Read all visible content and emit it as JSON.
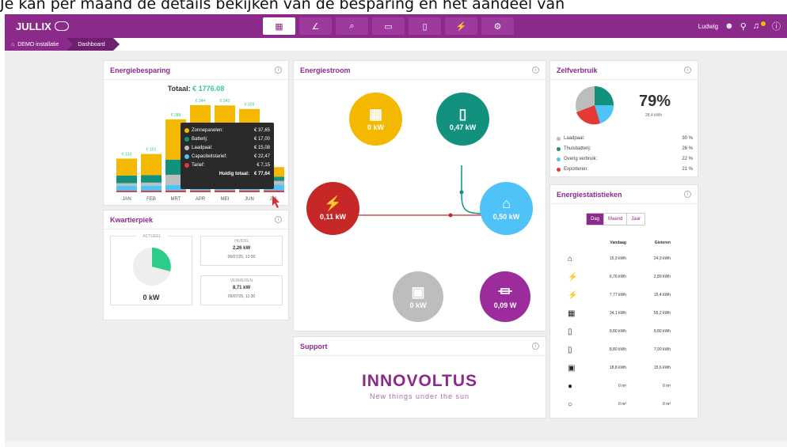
{
  "caption": "Je kan per maand de details bekijken van de besparing en het aandeel van",
  "app": {
    "logo": "JULLIX"
  },
  "nav": {
    "buttons": [
      "▦",
      "∠",
      "⌕",
      "▭",
      "▯",
      "⚡",
      "⚙"
    ]
  },
  "user": {
    "name": "Ludwig"
  },
  "breadcrumb": {
    "home": "⌂",
    "level1": "DEMO installatie",
    "level2": "Dashboard"
  },
  "cards": {
    "savings": {
      "title": "Energiebesparing",
      "total_label": "Totaal:",
      "total_value": "€ 1776.08"
    },
    "peak": {
      "title": "Kwartierpiek",
      "current_label": "ACTUEEL",
      "current_value": "0 kW",
      "today_label": "HUIDIG",
      "today_value": "2,26 kW",
      "today_date": "06/07/25, 12:00",
      "prev_label": "VERMEDEN",
      "prev_value": "8,71 kW",
      "prev_date": "09/07/25, 11:30"
    },
    "flow": {
      "title": "Energiestroom",
      "solar": "0 kW",
      "battery": "0,47 kW",
      "grid": "0,11 kW",
      "home": "0,50 kW",
      "car": "0 kW",
      "plug": "0,09 W"
    },
    "self": {
      "title": "Zelfverbruik",
      "percent": "79%",
      "sub": "28,4 kWh",
      "legend": [
        {
          "name": "Laadpaal:",
          "value": "30 %",
          "color": "#bdbdbd"
        },
        {
          "name": "Thuisbatterij:",
          "value": "26 %",
          "color": "#11917e"
        },
        {
          "name": "Overig verbruik:",
          "value": "22 %",
          "color": "#4fc3f7"
        },
        {
          "name": "Exporteren:",
          "value": "21 %",
          "color": "#e53935"
        }
      ]
    },
    "stats": {
      "title": "Energiestatistieken",
      "tabs": [
        "Dag",
        "Maand",
        "Jaar"
      ],
      "col_today": "Vandaag",
      "col_yesterday": "Gisteren",
      "rows": [
        {
          "icon": "⌂",
          "today": "15,3 kWh",
          "yesterday": "24,3 kWh"
        },
        {
          "icon": "⚡",
          "today": "6,76 kWh",
          "yesterday": "2,89 kWh"
        },
        {
          "icon": "⚡",
          "today": "7,77 kWh",
          "yesterday": "15,4 kWh"
        },
        {
          "icon": "▦",
          "today": "34,1 kWh",
          "yesterday": "55,2 kWh"
        },
        {
          "icon": "▯",
          "today": "9,80 kWh",
          "yesterday": "9,80 kWh"
        },
        {
          "icon": "▯",
          "today": "8,80 kWh",
          "yesterday": "7,90 kWh"
        },
        {
          "icon": "▣",
          "today": "18,8 kWh",
          "yesterday": "15,6 kWh"
        },
        {
          "icon": "●",
          "today": "0 m³",
          "yesterday": "0 m³"
        },
        {
          "icon": "○",
          "today": "0 m³",
          "yesterday": "0 m³"
        }
      ]
    },
    "support": {
      "title": "Support",
      "logo": "INNOVOLTUS",
      "tagline": "New things under the sun"
    }
  },
  "tooltip": {
    "rows": [
      {
        "name": "Zonnepanelen:",
        "value": "€ 37,65",
        "color": "#f5b800"
      },
      {
        "name": "Batterij:",
        "value": "€ 17,00",
        "color": "#11917e"
      },
      {
        "name": "Laadpaal:",
        "value": "€ 15,08",
        "color": "#bdbdbd"
      },
      {
        "name": "Capaciteitstarief:",
        "value": "€ 22,47",
        "color": "#4fc3f7"
      },
      {
        "name": "Tarief:",
        "value": "€ 7,15",
        "color": "#e53935"
      }
    ],
    "total_label": "Huidig totaal:",
    "total_value": "€ 77,64"
  },
  "chart_data": {
    "type": "bar",
    "categories": [
      "JAN",
      "FEB",
      "MRT",
      "APR",
      "MEI",
      "JUN",
      "JUL"
    ],
    "top_labels": [
      "€ 133",
      "€ 151",
      "€ 288",
      "€ 344",
      "€ 343",
      "€ 329",
      ""
    ],
    "series": [
      {
        "name": "Tarief",
        "color": "#e53935",
        "values": [
          6,
          6,
          7,
          7,
          7,
          7,
          7.15
        ]
      },
      {
        "name": "Capaciteitstarief",
        "color": "#4fc3f7",
        "values": [
          20,
          20,
          22,
          22,
          22,
          22,
          22.47
        ]
      },
      {
        "name": "Laadpaal",
        "color": "#bdbdbd",
        "values": [
          10,
          12,
          40,
          45,
          40,
          35,
          15.08
        ]
      },
      {
        "name": "Batterij",
        "color": "#11917e",
        "values": [
          30,
          30,
          60,
          70,
          70,
          65,
          17
        ]
      },
      {
        "name": "Zonnepanelen",
        "color": "#f5b800",
        "values": [
          67,
          83,
          159,
          200,
          204,
          200,
          37.65
        ]
      }
    ],
    "ylim": [
      0,
      350
    ],
    "grid": false,
    "legend": "none"
  },
  "colors": {
    "brand": "#8b2a8b",
    "accent": "#2ecc8a",
    "solar": "#f5b800",
    "battery": "#11917e",
    "grid": "#c62828",
    "home": "#4fc3f7",
    "car": "#bdbdbd",
    "plug": "#9c2c9c"
  }
}
